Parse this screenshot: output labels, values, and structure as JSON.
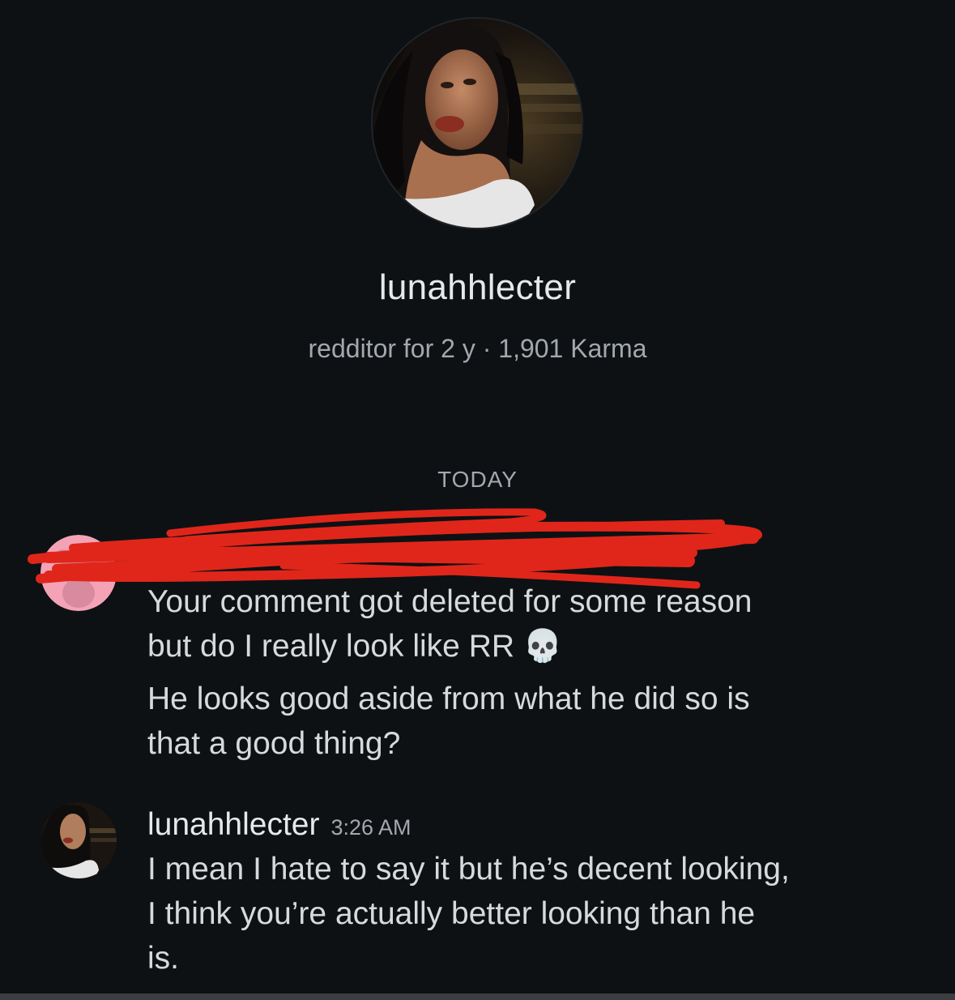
{
  "profile": {
    "username": "lunahhlecter",
    "meta": "redditor for 2 y · 1,901 Karma"
  },
  "divider": {
    "label": "TODAY"
  },
  "messages": [
    {
      "lines": [
        "Your comment got deleted for some reason",
        "but do I really look like RR 💀",
        "He looks good aside from what he did so is",
        "that a good thing?"
      ]
    },
    {
      "author": "lunahhlecter",
      "time": "3:26 AM",
      "lines": [
        "I mean I hate to say it but he’s decent looking,",
        "I think you’re actually better looking than he",
        "is."
      ]
    }
  ],
  "colors": {
    "background": "#0e1114",
    "text": "#d7dadc",
    "muted": "#a3a8ad",
    "redaction": "#e0261a",
    "snoo_avatar": "#f4a3b6"
  }
}
